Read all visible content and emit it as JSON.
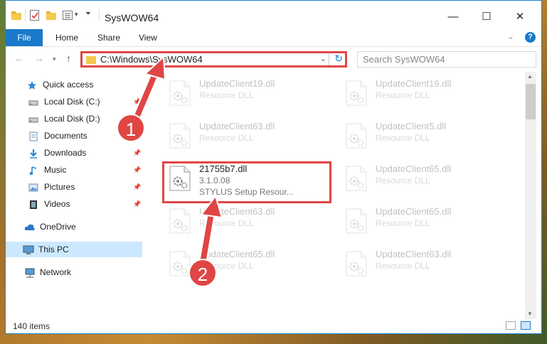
{
  "window": {
    "title": "SysWOW64",
    "controls": {
      "minimize": "—",
      "maximize": "☐",
      "close": "✕"
    }
  },
  "ribbon": {
    "tabs": [
      "File",
      "Home",
      "Share",
      "View"
    ],
    "help": "?"
  },
  "navigation": {
    "address": "C:\\Windows\\SysWOW64",
    "search_placeholder": "Search SysWOW64"
  },
  "sidebar": {
    "items": [
      {
        "label": "Quick access",
        "icon": "star-icon"
      },
      {
        "label": "Local Disk (C:)",
        "icon": "drive-icon",
        "pinned": true
      },
      {
        "label": "Local Disk (D:)",
        "icon": "drive-icon",
        "pinned": true
      },
      {
        "label": "Documents",
        "icon": "documents-icon",
        "pinned": true
      },
      {
        "label": "Downloads",
        "icon": "download-icon",
        "pinned": true
      },
      {
        "label": "Music",
        "icon": "music-icon",
        "pinned": true
      },
      {
        "label": "Pictures",
        "icon": "pictures-icon",
        "pinned": true
      },
      {
        "label": "Videos",
        "icon": "videos-icon",
        "pinned": true
      },
      {
        "label": "OneDrive",
        "icon": "cloud-icon"
      },
      {
        "label": "This PC",
        "icon": "computer-icon",
        "selected": true
      },
      {
        "label": "Network",
        "icon": "network-icon"
      }
    ]
  },
  "files": [
    {
      "name": "UpdateClient19.dll",
      "line2": "Resource DLL"
    },
    {
      "name": "UpdateClient19.dll",
      "line2": "Resource DLL"
    },
    {
      "name": "UpdateClient63.dll",
      "line2": "Resource DLL"
    },
    {
      "name": "UpdateClient5.dll",
      "line2": "Resource DLL"
    },
    {
      "name": "21755b7.dll",
      "line2": "3.1.0.08",
      "line3": "STYLUS Setup Resour..."
    },
    {
      "name": "UpdateClient65.dll",
      "line2": "Resource DLL"
    },
    {
      "name": "UpdateClient63.dll",
      "line2": "Resource DLL"
    },
    {
      "name": "UpdateClient65.dll",
      "line2": "Resource DLL"
    },
    {
      "name": "UpdateClient65.dll",
      "line2": "Resource DLL"
    },
    {
      "name": "UpdateClient63.dll",
      "line2": "Resource DLL"
    }
  ],
  "status": {
    "items_count": "140 items"
  },
  "annotations": {
    "step1": "1",
    "step2": "2"
  },
  "colors": {
    "accent": "#1979ca",
    "highlight": "#e04646"
  }
}
